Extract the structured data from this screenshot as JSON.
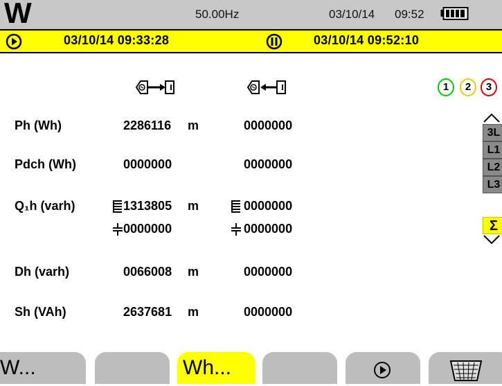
{
  "status_bar": {
    "brand_glyph": "W",
    "frequency": "50.00Hz",
    "date": "03/10/14",
    "time": "09:52"
  },
  "record_bar": {
    "start_datetime": "03/10/14  09:33:28",
    "end_datetime": "03/10/14  09:52:10"
  },
  "columns": {
    "left_icon": "energy-generated-icon",
    "right_icon": "energy-consumed-icon"
  },
  "phases": [
    {
      "label": "1",
      "color": "#00cc00"
    },
    {
      "label": "2",
      "color": "#e6d200"
    },
    {
      "label": "3",
      "color": "#e00000"
    }
  ],
  "rows": [
    {
      "label": "Ph (Wh)",
      "left": "2286116",
      "unit": "m",
      "right": "0000000"
    },
    {
      "label": "Pdch (Wh)",
      "left": "0000000",
      "unit": "",
      "right": "0000000"
    },
    {
      "label": "Q₁h (varh)",
      "left": "1313805",
      "unit": "m",
      "right": "0000000",
      "left2": "0000000",
      "right2": "0000000"
    },
    {
      "label": "Dh (varh)",
      "left": "0066008",
      "unit": "m",
      "right": "0000000"
    },
    {
      "label": "Sh (VAh)",
      "left": "2637681",
      "unit": "m",
      "right": "0000000"
    }
  ],
  "side_menu": [
    "3L",
    "L1",
    "L2",
    "L3",
    "Σ"
  ],
  "tabs": {
    "tab1": "W...",
    "tab3": "Wh..."
  }
}
